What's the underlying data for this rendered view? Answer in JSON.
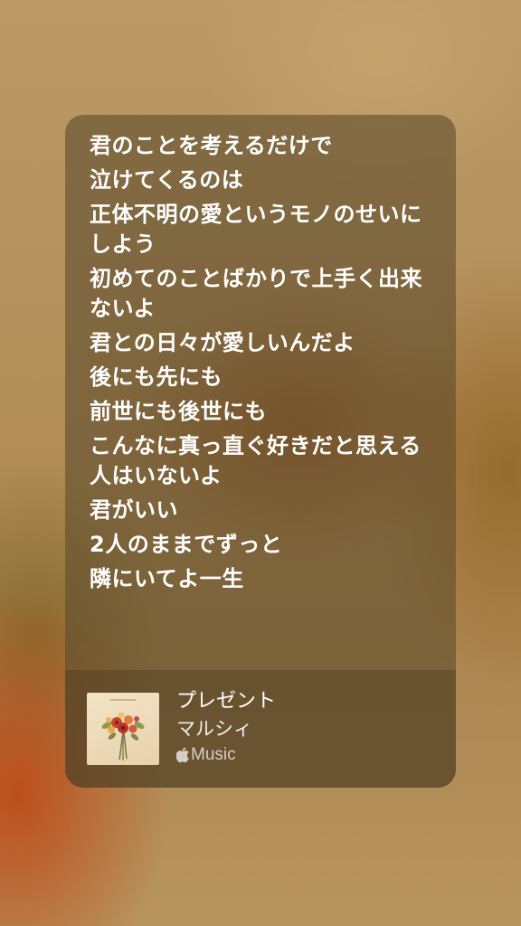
{
  "lyrics": [
    "君のことを考えるだけで",
    "泣けてくるのは",
    "正体不明の愛というモノのせいにしよう",
    "初めてのことばかりで上手く出来ないよ",
    "君との日々が愛しいんだよ",
    "後にも先にも",
    "前世にも後世にも",
    "こんなに真っ直ぐ好きだと思える人はいないよ",
    "君がいい",
    "2人のままでずっと",
    "隣にいてよ一生"
  ],
  "song": {
    "title": "プレゼント",
    "artist": "マルシィ",
    "service": "Music",
    "service_icon": "apple-logo-icon"
  },
  "colors": {
    "card_tint": "#5f4e2d",
    "text": "#ffffff",
    "background": "#b48f56"
  }
}
